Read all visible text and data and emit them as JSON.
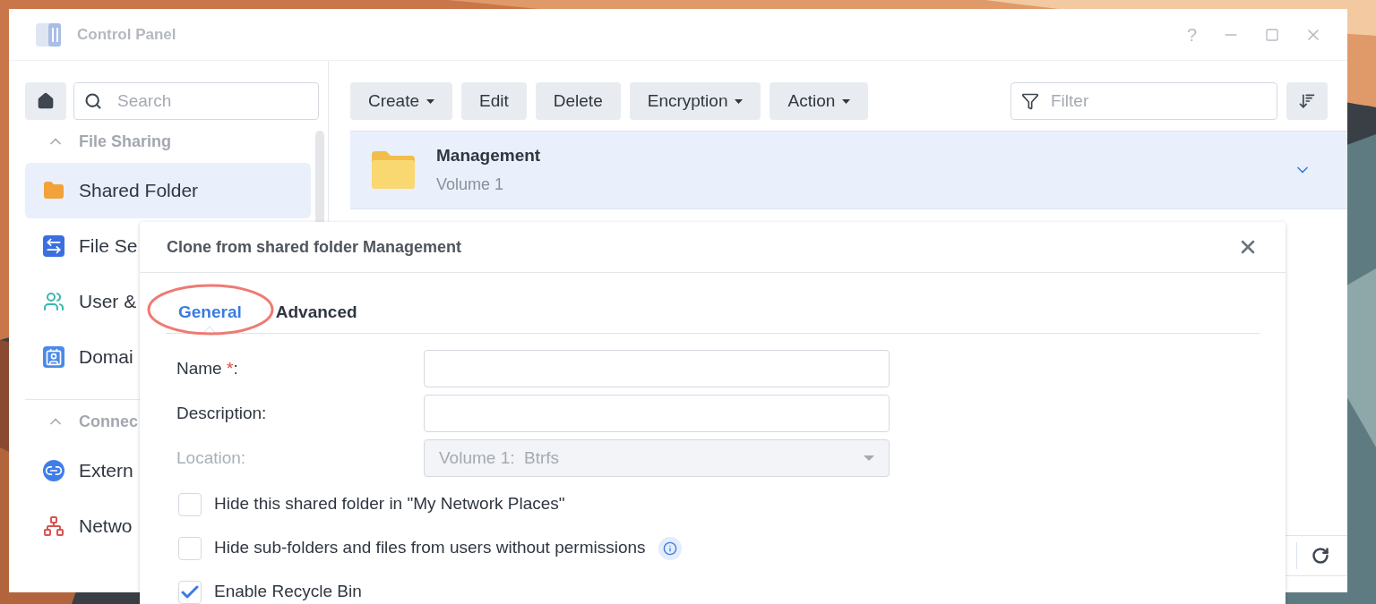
{
  "window": {
    "title": "Control Panel",
    "controls": [
      "?"
    ]
  },
  "sidebar": {
    "search": {
      "placeholder": "Search"
    },
    "sections": [
      {
        "title": "File Sharing",
        "expanded": true,
        "items": [
          {
            "label": "Shared Folder",
            "selected": true,
            "kind": "folder"
          },
          {
            "label": "File Se",
            "selected": false,
            "kind": "transfer"
          },
          {
            "label": "User &",
            "selected": false,
            "kind": "users"
          },
          {
            "label": "Domai",
            "selected": false,
            "kind": "domain"
          }
        ]
      },
      {
        "title": "Connec",
        "expanded": true,
        "items": [
          {
            "label": "Extern",
            "selected": false,
            "kind": "external"
          },
          {
            "label": "Netwo",
            "selected": false,
            "kind": "network"
          }
        ]
      }
    ]
  },
  "toolbar": {
    "buttons": [
      {
        "label": "Create",
        "dropdown": true
      },
      {
        "label": "Edit",
        "dropdown": false
      },
      {
        "label": "Delete",
        "dropdown": false
      },
      {
        "label": "Encryption",
        "dropdown": true
      },
      {
        "label": "Action",
        "dropdown": true
      }
    ],
    "filter": {
      "placeholder": "Filter"
    }
  },
  "folders": [
    {
      "name": "Management",
      "volume": "Volume 1",
      "selected": true
    }
  ],
  "dialog": {
    "title": "Clone from shared folder Management",
    "tabs": [
      {
        "label": "General",
        "selected": true
      },
      {
        "label": "Advanced",
        "selected": false
      }
    ],
    "fields": [
      {
        "label": "Name",
        "required_mark": "*",
        "label_end": ":",
        "disabled": false,
        "kind": "text"
      },
      {
        "label": "Description:",
        "disabled": false,
        "kind": "text"
      },
      {
        "label": "Location:",
        "disabled": true,
        "kind": "select",
        "value": "Volume 1:  Btrfs"
      }
    ],
    "checkboxes": [
      {
        "label": "Hide this shared folder in \"My Network Places\"",
        "checked": false,
        "info": false
      },
      {
        "label": "Hide sub-folders and files from users without permissions",
        "checked": false,
        "info": true
      },
      {
        "label": "Enable Recycle Bin",
        "checked": true,
        "info": false
      }
    ]
  }
}
